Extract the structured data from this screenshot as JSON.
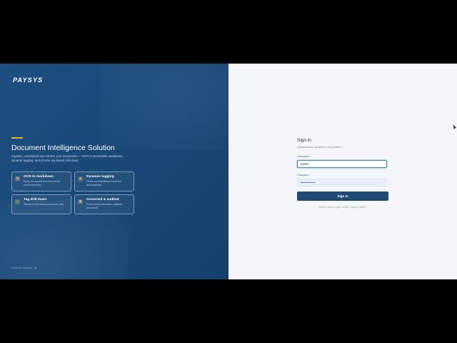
{
  "brand": {
    "logo_text": "PAYSYS"
  },
  "hero": {
    "headline": "Document Intelligence Solution",
    "description": "Capture, understand and retrieve your documents — OCR to searchable markdown, dynamic tagging, and precise tag-based drill-down.",
    "accent_color": "#e0b34a"
  },
  "features": [
    {
      "icon": "document-icon",
      "glyph": "▤",
      "title": "OCR to markdown",
      "text": "Every document becomes clean, searchable text."
    },
    {
      "icon": "tag-icon",
      "glyph": "◈",
      "title": "Dynamic tagging",
      "text": "Fields and identifiers extracted automatically."
    },
    {
      "icon": "search-icon",
      "glyph": "⌕",
      "title": "Tag drill-down",
      "text": "Narrow to the exact document, fast."
    },
    {
      "icon": "shield-icon",
      "glyph": "◆",
      "title": "Governed & audited",
      "text": "Every action recorded; originals preserved."
    }
  ],
  "footnote": "Proof of Concept · v1",
  "signin": {
    "title": "Sign in",
    "subtitle": "Administrator access to the platform.",
    "username_label": "Username",
    "username_value": "admin",
    "password_label": "Password",
    "password_value": "••••••••••",
    "button_label": "Sign in",
    "hint": "Default demo login: admin / paysys admin"
  },
  "colors": {
    "left_panel": "#1a4877",
    "right_panel": "#f4f6f9",
    "button": "#1f4a74"
  }
}
